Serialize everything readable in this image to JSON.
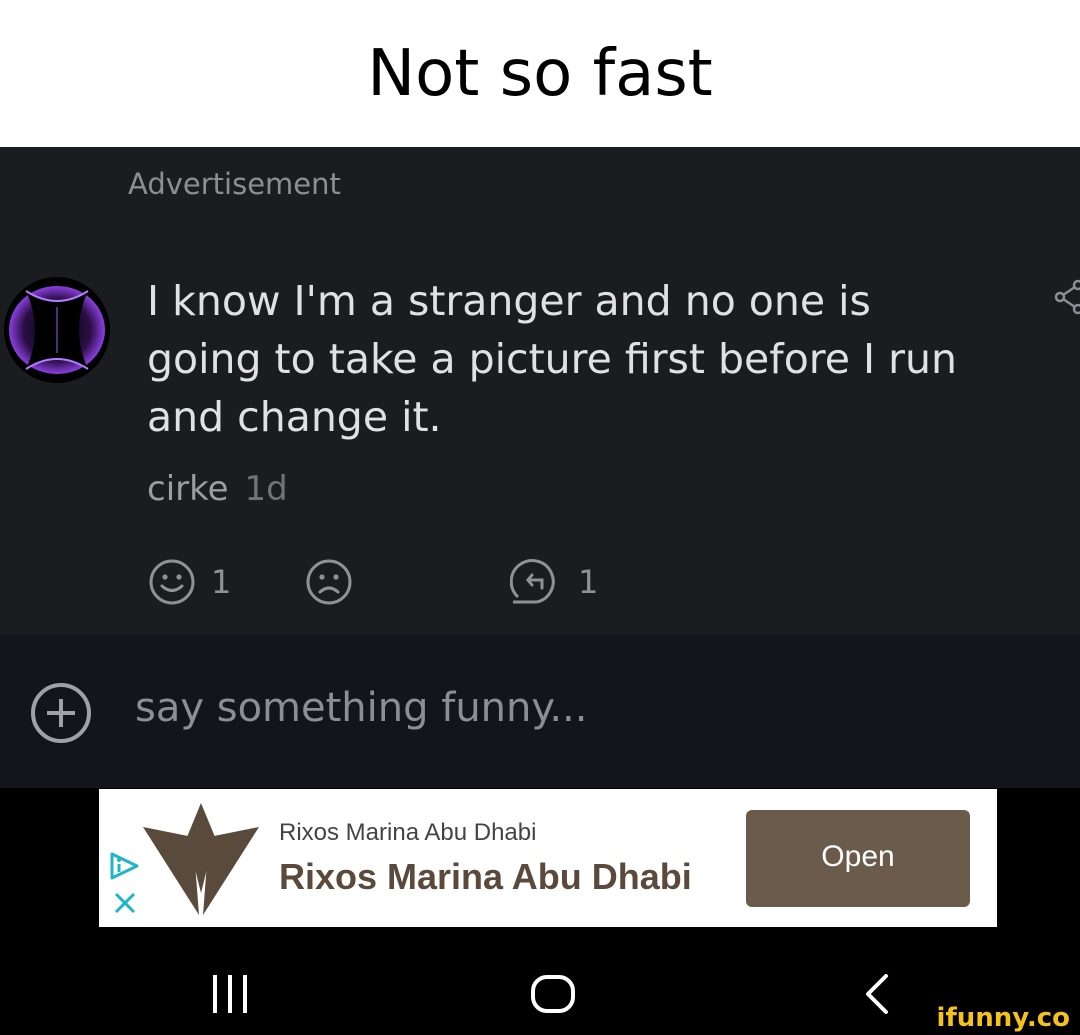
{
  "caption": {
    "title": "Not so fast"
  },
  "post": {
    "ad_label": "Advertisement",
    "avatar_icon": "purple-orb-avatar",
    "comment_text": "I know I'm a stranger and no one is going to take a picture first before I run and change it.",
    "username": "cirke",
    "time": "1d",
    "actions": {
      "smile_count": "1",
      "reply_count": "1"
    }
  },
  "composer": {
    "placeholder": "say something funny..."
  },
  "ad": {
    "small_title": "Rixos Marina Abu Dhabi",
    "title": "Rixos Marina Abu Dhabi",
    "button": "Open"
  },
  "watermark": "ifunny.co",
  "colors": {
    "background": "#1b1c20",
    "composer_bg": "#14151a",
    "ad_button": "#6b5b4b",
    "watermark": "#f4c21a"
  }
}
